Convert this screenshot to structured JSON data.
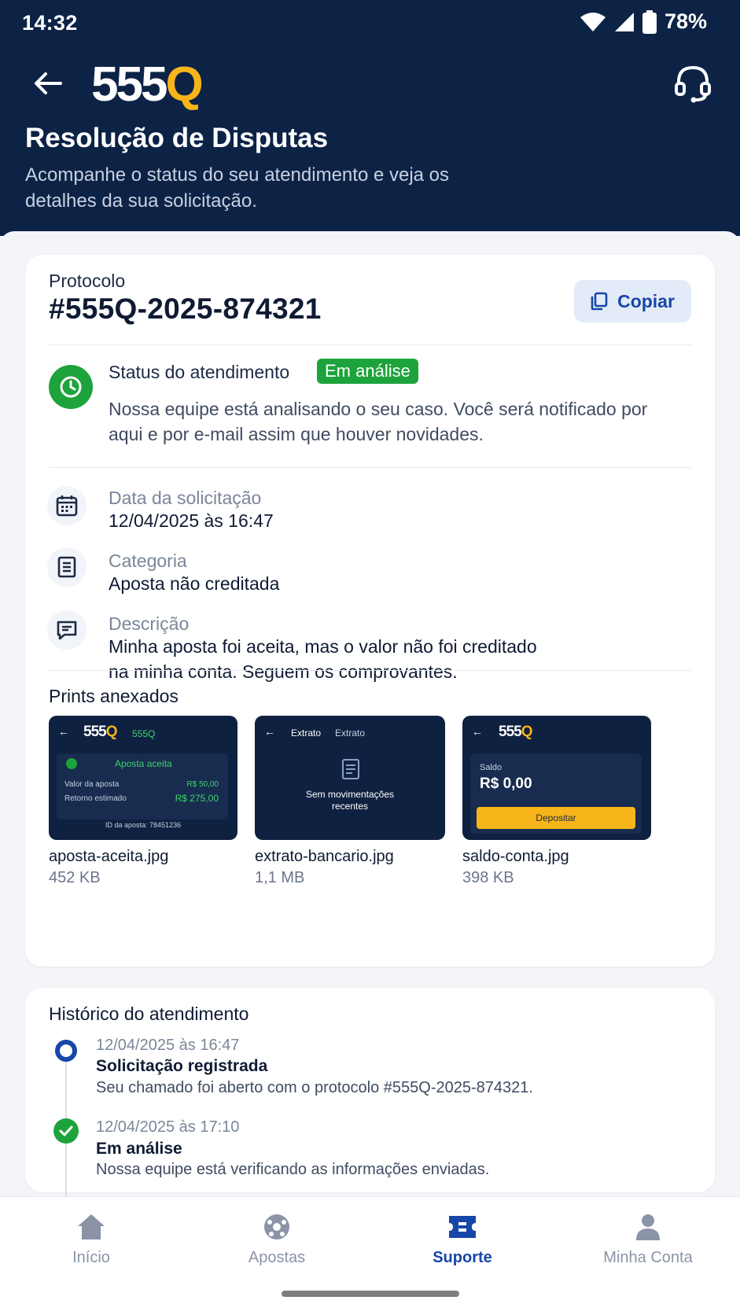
{
  "status_bar": {
    "time": "14:32",
    "battery": "78%"
  },
  "header": {
    "logo_part1": "555",
    "logo_part2": "Q",
    "title": "Resolução de Disputas",
    "subtitle": "Acompanhe o status do seu atendimento e veja os detalhes da sua solicitação."
  },
  "protocol": {
    "label": "Protocolo",
    "value": "#555Q-2025-874321",
    "copy_label": "Copiar"
  },
  "status": {
    "title": "Status do atendimento",
    "badge": "Em análise",
    "description": "Nossa equipe está analisando o seu caso. Você será notificado por aqui e por e-mail assim que houver novidades."
  },
  "details": {
    "date_label": "Data da solicitação",
    "date_value": "12/04/2025 às 16:47",
    "category_label": "Categoria",
    "category_value": "Aposta não creditada",
    "description_label": "Descrição",
    "description_value": "Minha aposta foi aceita, mas o valor não foi creditado na minha conta. Seguem os comprovantes."
  },
  "attachments": {
    "title": "Prints anexados",
    "items": [
      {
        "name": "aposta-aceita.jpg",
        "size": "452 KB",
        "preview": {
          "logo1": "555",
          "logo2": "Q",
          "tag": "555Q",
          "heading": "Aposta aceita",
          "row1_label": "Valor da aposta",
          "row1_value": "R$ 50,00",
          "row2_label": "Retorno estimado",
          "row2_value": "R$ 275,00",
          "footer": "ID da aposta: 78451236"
        }
      },
      {
        "name": "extrato-bancario.jpg",
        "size": "1,1 MB",
        "preview": {
          "title1": "Extrato",
          "title2": "Extrato",
          "message": "Sem movimentações recentes"
        }
      },
      {
        "name": "saldo-conta.jpg",
        "size": "398 KB",
        "preview": {
          "logo1": "555",
          "logo2": "Q",
          "balance_label": "Saldo",
          "balance_value": "R$ 0,00",
          "button": "Depositar"
        }
      }
    ]
  },
  "history": {
    "title": "Histórico do atendimento",
    "events": [
      {
        "time": "12/04/2025 às 16:47",
        "title": "Solicitação registrada",
        "description": "Seu chamado foi aberto com o protocolo #555Q-2025-874321."
      },
      {
        "time": "12/04/2025 às 17:10",
        "title": "Em análise",
        "description": "Nossa equipe está verificando as informações enviadas."
      }
    ]
  },
  "nav": {
    "items": [
      {
        "label": "Início",
        "icon": "home-icon"
      },
      {
        "label": "Apostas",
        "icon": "soccer-ball-icon"
      },
      {
        "label": "Suporte",
        "icon": "ticket-icon",
        "active": true
      },
      {
        "label": "Minha Conta",
        "icon": "user-icon"
      }
    ]
  },
  "colors": {
    "header_bg": "#0c2346",
    "brand_yellow": "#f7b519",
    "accent_blue": "#1646a8",
    "success_green": "#1da33b"
  }
}
